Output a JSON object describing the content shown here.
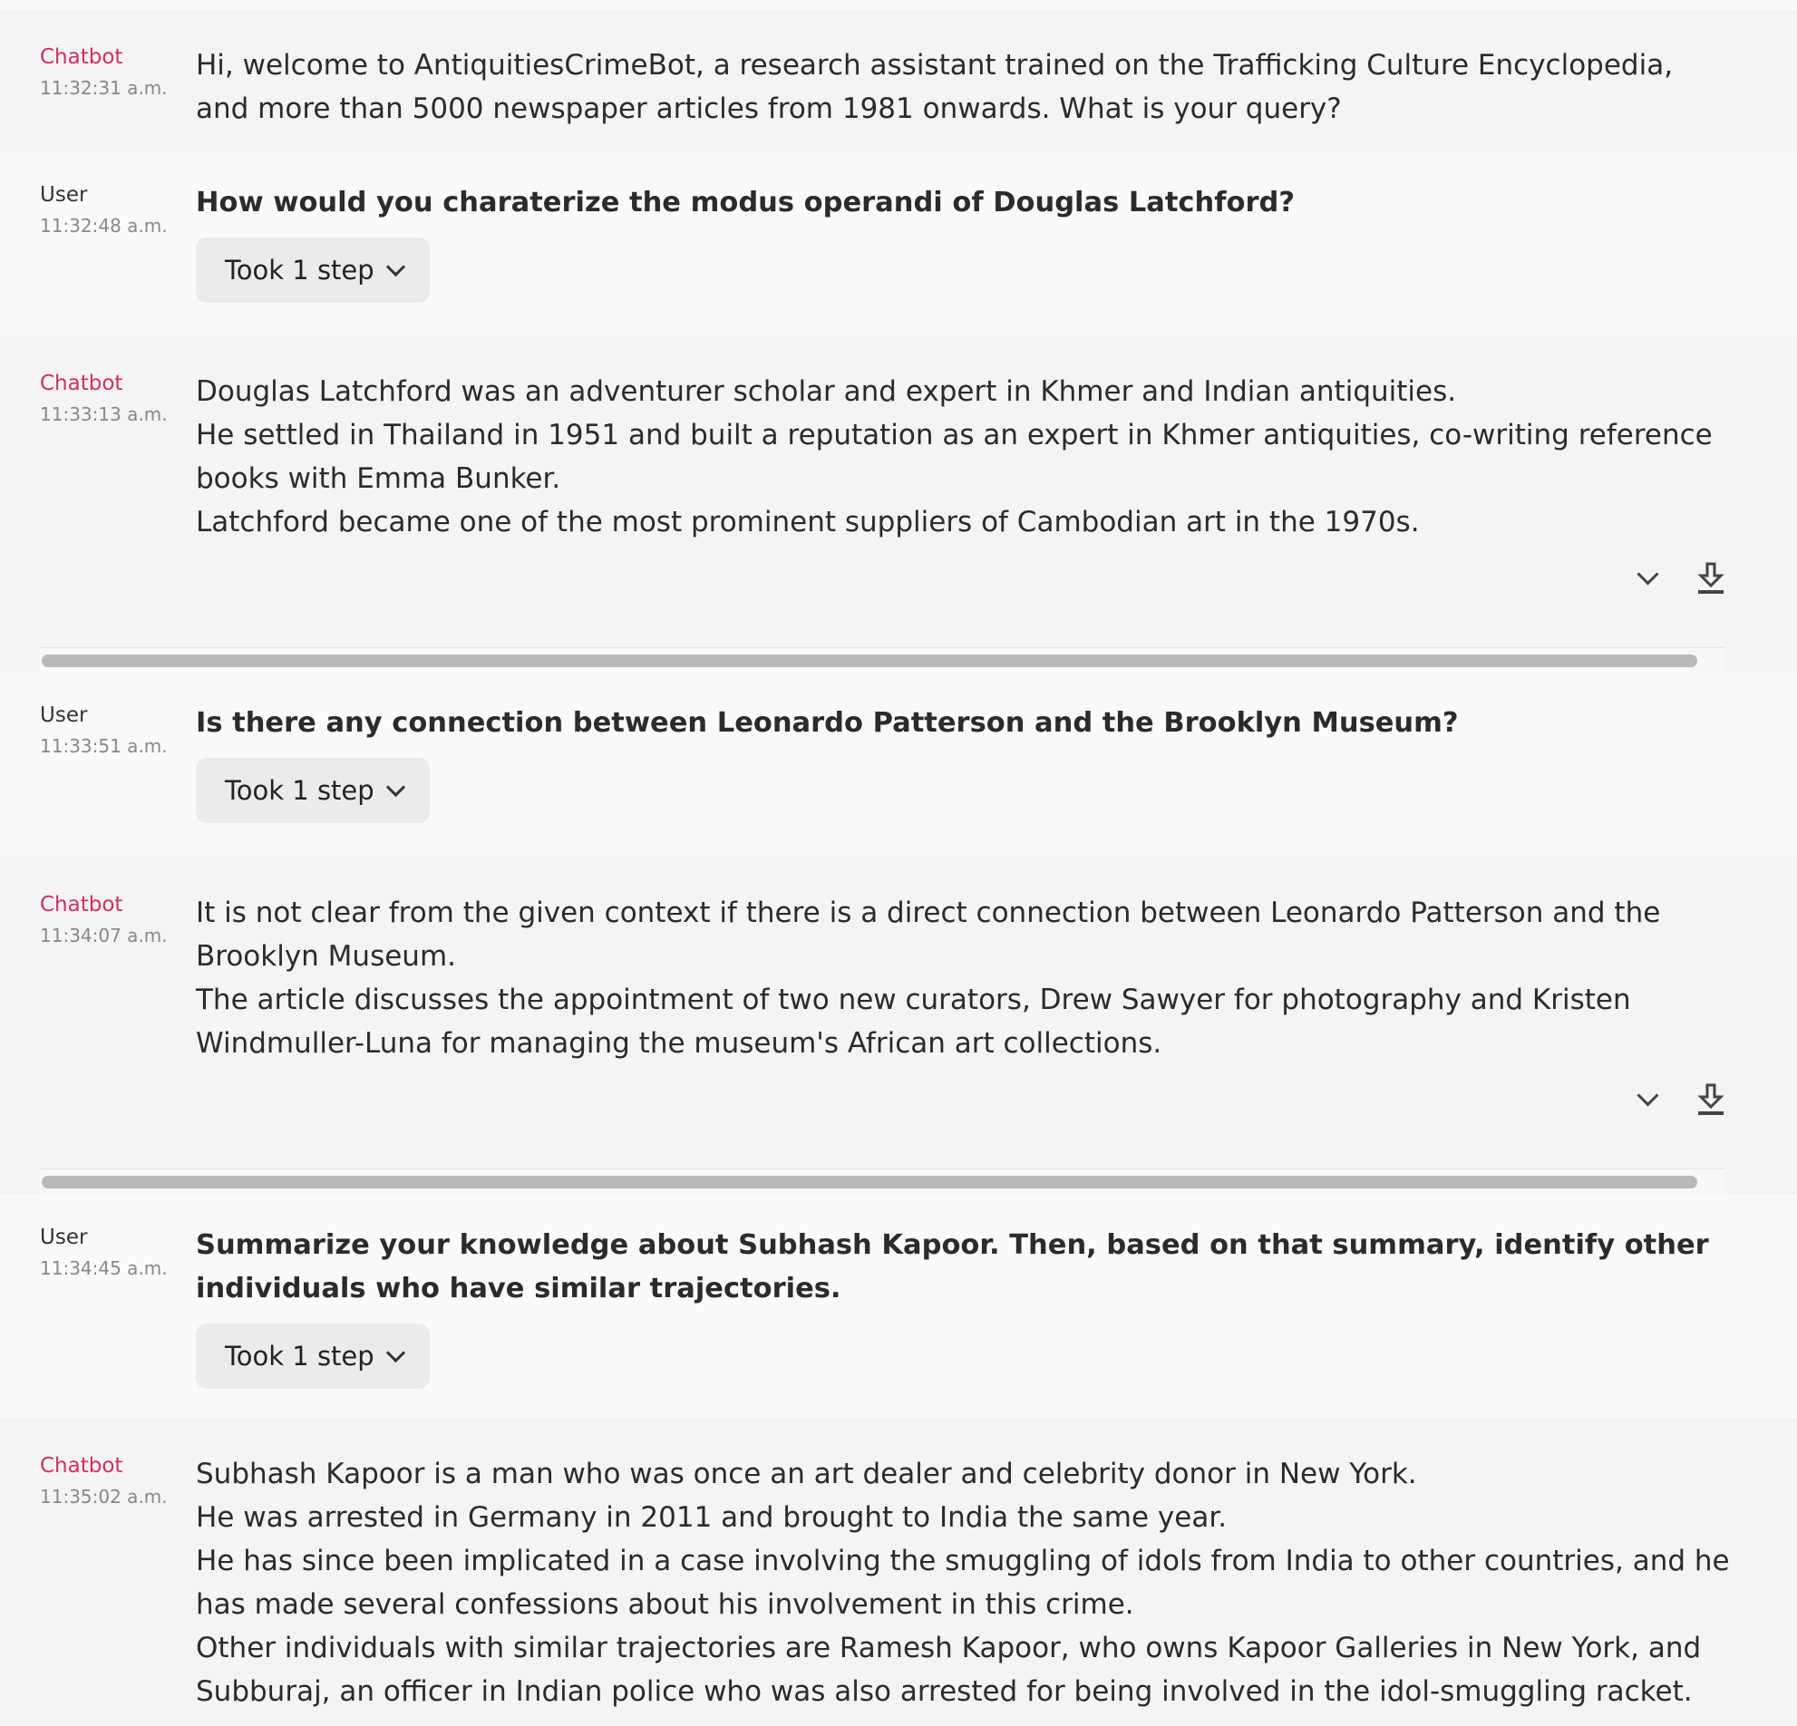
{
  "messages": [
    {
      "role": "Chatbot",
      "time": "11:32:31 a.m.",
      "lines": [
        "Hi, welcome to AntiquitiesCrimeBot, a research assistant trained on the Trafficking Culture Encyclopedia, and more than 5000 newspaper articles from 1981 onwards. What is your query?"
      ]
    },
    {
      "role": "User",
      "time": "11:32:48 a.m.",
      "lines": [
        "How would you charaterize the modus operandi of Douglas Latchford?"
      ],
      "steps_label": "Took 1 step"
    },
    {
      "role": "Chatbot",
      "time": "11:33:13 a.m.",
      "lines": [
        "Douglas Latchford was an adventurer scholar and expert in Khmer and Indian antiquities.",
        "He settled in Thailand in 1951 and built a reputation as an expert in Khmer antiquities, co-writing reference books with Emma Bunker.",
        "Latchford became one of the most prominent suppliers of Cambodian art in the 1970s."
      ]
    },
    {
      "role": "User",
      "time": "11:33:51 a.m.",
      "lines": [
        "Is there any connection between Leonardo Patterson and the Brooklyn Museum?"
      ],
      "steps_label": "Took 1 step"
    },
    {
      "role": "Chatbot",
      "time": "11:34:07 a.m.",
      "lines": [
        "It is not clear from the given context if there is a direct connection between Leonardo Patterson and the Brooklyn Museum.",
        "The article discusses the appointment of two new curators, Drew Sawyer for photography and Kristen Windmuller-Luna for managing the museum's African art collections."
      ]
    },
    {
      "role": "User",
      "time": "11:34:45 a.m.",
      "lines": [
        "Summarize your knowledge about Subhash Kapoor. Then, based on that summary, identify other individuals who have similar trajectories."
      ],
      "steps_label": "Took 1 step"
    },
    {
      "role": "Chatbot",
      "time": "11:35:02 a.m.",
      "lines": [
        "Subhash Kapoor is a man who was once an art dealer and celebrity donor in New York.",
        "He was arrested in Germany in 2011 and brought to India the same year.",
        "He has since been implicated in a case involving the smuggling of idols from India to other countries, and he has made several confessions about his involvement in this crime.",
        "Other individuals with similar trajectories are Ramesh Kapoor, who owns Kapoor Galleries in New York, and Subburaj, an officer in Indian police who was also arrested for being involved in the idol-smuggling racket."
      ]
    }
  ]
}
